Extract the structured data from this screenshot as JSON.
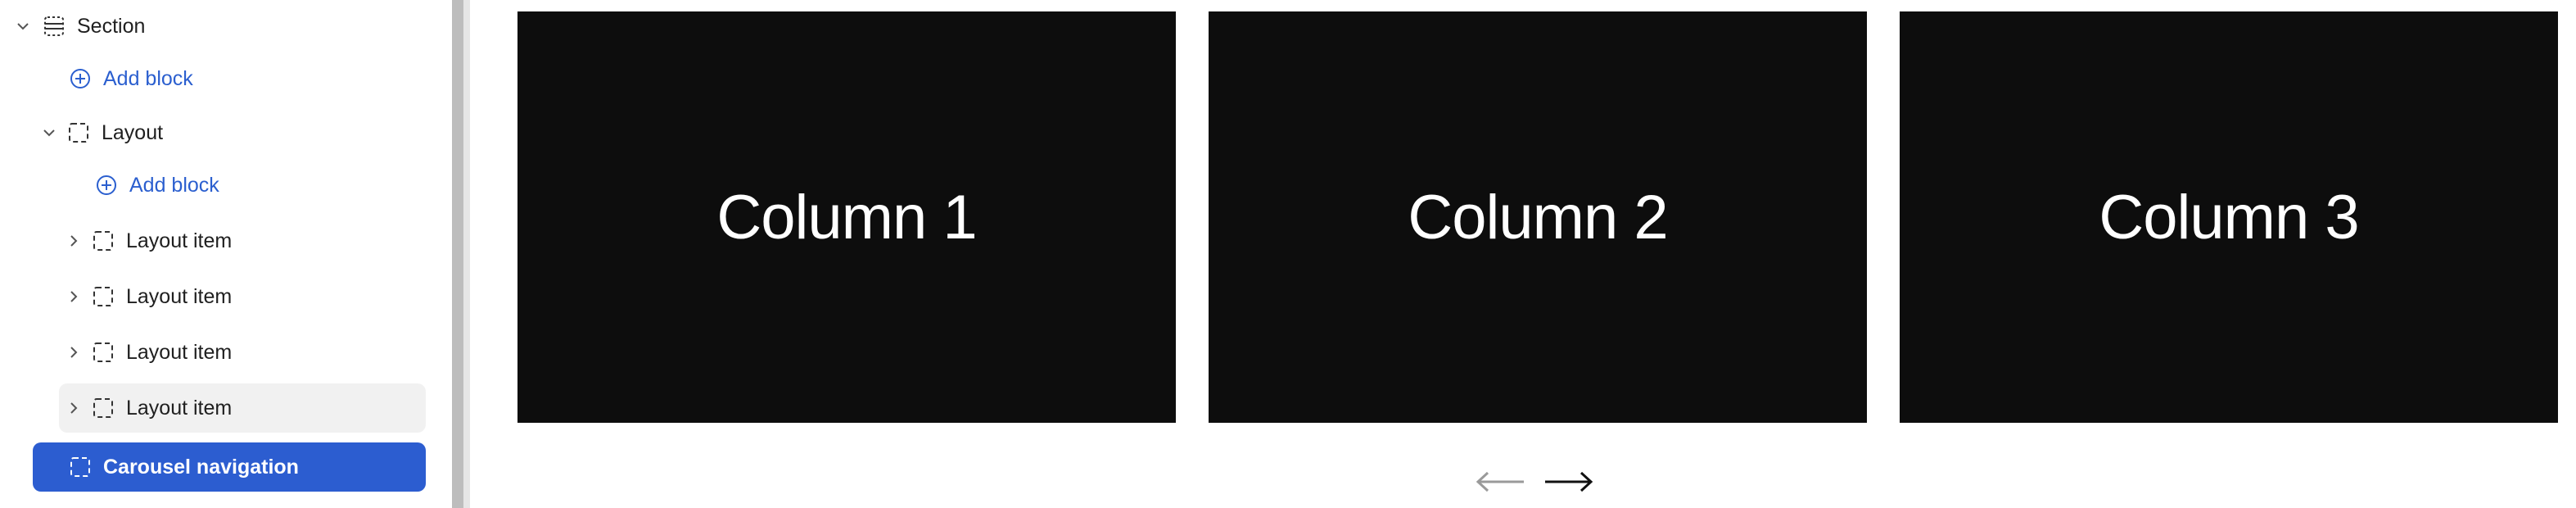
{
  "sidebar": {
    "section_label": "Section",
    "add_block_1": "Add block",
    "layout_label": "Layout",
    "add_block_2": "Add block",
    "layout_items": [
      "Layout item",
      "Layout item",
      "Layout item",
      "Layout item"
    ],
    "selected_label": "Carousel navigation"
  },
  "canvas": {
    "columns": [
      "Column 1",
      "Column 2",
      "Column 3"
    ]
  },
  "colors": {
    "accent": "#2c5dd0",
    "link": "#2b5fcf",
    "column_bg": "#0d0d0d"
  },
  "icons": {
    "section": "section-icon",
    "layout": "dashed-square-icon",
    "add": "plus-circle-icon",
    "prev": "arrow-left-icon",
    "next": "arrow-right-icon"
  }
}
